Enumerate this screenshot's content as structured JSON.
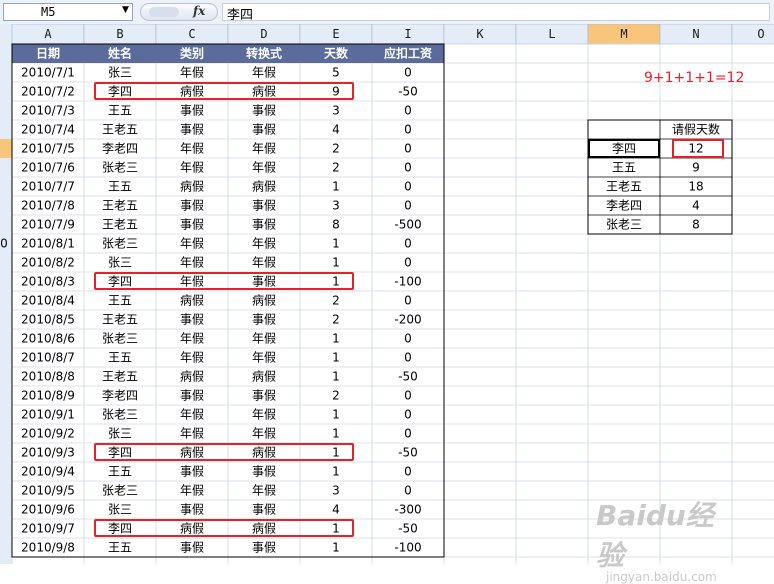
{
  "formula_bar": {
    "name_box": "M5",
    "fx_label": "fx",
    "formula": "李四"
  },
  "column_headers": [
    "A",
    "B",
    "C",
    "D",
    "E",
    "I",
    "K",
    "L",
    "M",
    "N",
    "O"
  ],
  "table_headers": [
    "日期",
    "姓名",
    "类别",
    "转换式",
    "天数",
    "应扣工资"
  ],
  "rows": [
    [
      "2010/7/1",
      "张三",
      "年假",
      "年假",
      "5",
      "0"
    ],
    [
      "2010/7/2",
      "李四",
      "病假",
      "病假",
      "9",
      "-50"
    ],
    [
      "2010/7/3",
      "王五",
      "事假",
      "事假",
      "3",
      "0"
    ],
    [
      "2010/7/4",
      "王老五",
      "事假",
      "事假",
      "4",
      "0"
    ],
    [
      "2010/7/5",
      "李老四",
      "年假",
      "年假",
      "2",
      "0"
    ],
    [
      "2010/7/6",
      "张老三",
      "年假",
      "年假",
      "2",
      "0"
    ],
    [
      "2010/7/7",
      "王五",
      "病假",
      "病假",
      "1",
      "0"
    ],
    [
      "2010/7/8",
      "王老五",
      "事假",
      "事假",
      "3",
      "0"
    ],
    [
      "2010/7/9",
      "王老五",
      "事假",
      "事假",
      "8",
      "-500"
    ],
    [
      "2010/8/1",
      "张老三",
      "年假",
      "年假",
      "1",
      "0"
    ],
    [
      "2010/8/2",
      "张三",
      "年假",
      "年假",
      "1",
      "0"
    ],
    [
      "2010/8/3",
      "李四",
      "年假",
      "事假",
      "1",
      "-100"
    ],
    [
      "2010/8/4",
      "王五",
      "病假",
      "病假",
      "2",
      "0"
    ],
    [
      "2010/8/5",
      "王老五",
      "事假",
      "事假",
      "2",
      "-200"
    ],
    [
      "2010/8/6",
      "张老三",
      "年假",
      "年假",
      "1",
      "0"
    ],
    [
      "2010/8/7",
      "王五",
      "年假",
      "年假",
      "1",
      "0"
    ],
    [
      "2010/8/8",
      "王老五",
      "病假",
      "病假",
      "1",
      "-50"
    ],
    [
      "2010/8/9",
      "李老四",
      "事假",
      "事假",
      "2",
      "0"
    ],
    [
      "2010/9/1",
      "张老三",
      "年假",
      "年假",
      "1",
      "0"
    ],
    [
      "2010/9/2",
      "张三",
      "年假",
      "年假",
      "1",
      "0"
    ],
    [
      "2010/9/3",
      "李四",
      "病假",
      "病假",
      "1",
      "-50"
    ],
    [
      "2010/9/4",
      "王五",
      "事假",
      "事假",
      "1",
      "0"
    ],
    [
      "2010/9/5",
      "张老三",
      "年假",
      "年假",
      "3",
      "0"
    ],
    [
      "2010/9/6",
      "张三",
      "事假",
      "事假",
      "4",
      "-300"
    ],
    [
      "2010/9/7",
      "李四",
      "病假",
      "病假",
      "1",
      "-50"
    ],
    [
      "2010/9/8",
      "王五",
      "事假",
      "事假",
      "1",
      "-100"
    ]
  ],
  "row_number_fragments": [
    "",
    "",
    "",
    "",
    "",
    "",
    "",
    "",
    "",
    "0",
    "",
    "",
    "",
    "",
    "",
    "",
    "",
    "",
    "",
    "",
    "",
    "",
    "",
    "",
    "",
    ""
  ],
  "summary": {
    "header": "请假天数",
    "rows": [
      {
        "name": "李四",
        "days": "12"
      },
      {
        "name": "王五",
        "days": "9"
      },
      {
        "name": "王老五",
        "days": "18"
      },
      {
        "name": "李老四",
        "days": "4"
      },
      {
        "name": "张老三",
        "days": "8"
      }
    ]
  },
  "annotation": "9+1+1+1=12",
  "watermark": {
    "logo": "Baidu经验",
    "sub": "jingyan.baidu.com"
  },
  "colors": {
    "table_header_bg": "#5a6b9c",
    "highlight_red": "#e8202a",
    "col_header_bg": "#e4ecf7",
    "col_header_selected": "#f8c67a",
    "grid_line": "#d0d7e5"
  }
}
